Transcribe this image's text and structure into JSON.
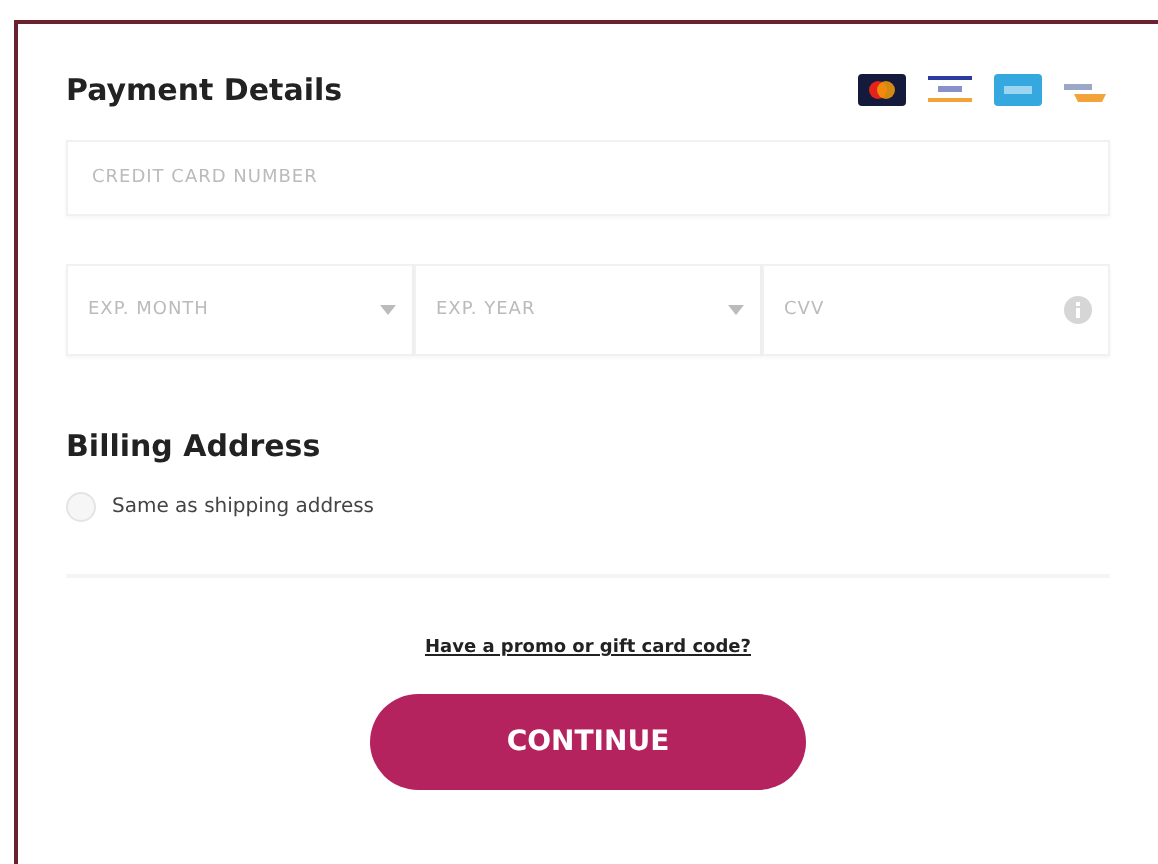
{
  "payment": {
    "title": "Payment Details",
    "card_number": {
      "placeholder": "CREDIT CARD NUMBER"
    },
    "exp_month": {
      "placeholder": "EXP. MONTH"
    },
    "exp_year": {
      "placeholder": "EXP. YEAR"
    },
    "cvv": {
      "placeholder": "CVV"
    }
  },
  "billing": {
    "title": "Billing Address",
    "same_as_shipping": {
      "label": "Same as shipping address",
      "checked": false
    }
  },
  "promo_link": "Have a promo or gift card code?",
  "continue_button": "CONTINUE"
}
